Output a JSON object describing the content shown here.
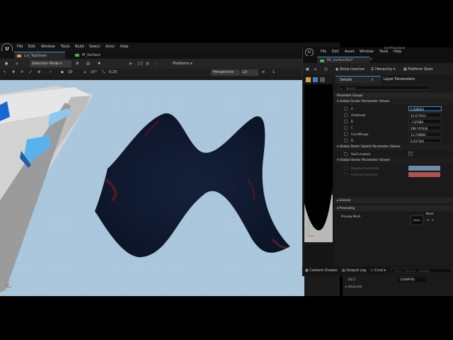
{
  "main_window": {
    "menu": [
      "File",
      "Edit",
      "Window",
      "Tools",
      "Build",
      "Select",
      "Actor",
      "Help"
    ],
    "tabs": [
      {
        "label": "Lvl_TopDown",
        "active": true
      },
      {
        "label": "M_Surface",
        "active": false
      }
    ],
    "toolbar": {
      "selection_mode": "Selection Mode",
      "platforms": "Platforms"
    },
    "viewport_toolbar": {
      "snap_grid": "10",
      "snap_angle": "10°",
      "snap_scale": "0.25",
      "perspective": "Perspective",
      "lit": "Lit",
      "camera_speed": "1"
    },
    "kill_z_label": "Kill Z",
    "kill_z_value": "-10489760",
    "advanced_label": "Advanced"
  },
  "material_editor": {
    "project_name": "GenProcedural",
    "menu": [
      "File",
      "Edit",
      "Asset",
      "Window",
      "Tools",
      "Help"
    ],
    "tab_label": "ML_SurfaceTest*",
    "toolbar": {
      "show_inactive": "Show Inactive",
      "hierarchy": "Hierarchy",
      "platform_stats": "Platform Stats"
    },
    "details_tabs": [
      "Details",
      "Layer Parameters"
    ],
    "search_placeholder": "Search",
    "parameter_groups": "Parameter Groups",
    "scalar_group": "Global Scalar Parameter Values",
    "scalar_params": [
      {
        "name": "A",
        "value": "0.008904"
      },
      {
        "name": "Amplitude",
        "value": "45.677633"
      },
      {
        "name": "B",
        "value": "-7.87089"
      },
      {
        "name": "C",
        "value": "299.767638"
      },
      {
        "name": "CoordRange",
        "value": "13.728090"
      },
      {
        "name": "D",
        "value": "6.037305"
      }
    ],
    "switch_group": "Global Static Switch Parameter Values",
    "switch_params": [
      {
        "name": "SeeCurvature",
        "checked": true
      }
    ],
    "vector_group": "Global Vector Parameter Values",
    "vector_params": [
      {
        "name": "NegativeCurveColor",
        "color": "#6f8aa6"
      },
      {
        "name": "PositiveCurveColor",
        "color": "#b1524c"
      }
    ],
    "general_label": "General",
    "previewing_label": "Previewing",
    "preview_mesh_label": "Preview Mesh",
    "preview_mesh_none": "None",
    "preview_mesh_value": "None"
  },
  "bottom_bar": {
    "content_drawer": "Content Drawer",
    "output_log": "Output Log",
    "cmd": "Cmd",
    "console_placeholder": "Enter Console Command"
  }
}
